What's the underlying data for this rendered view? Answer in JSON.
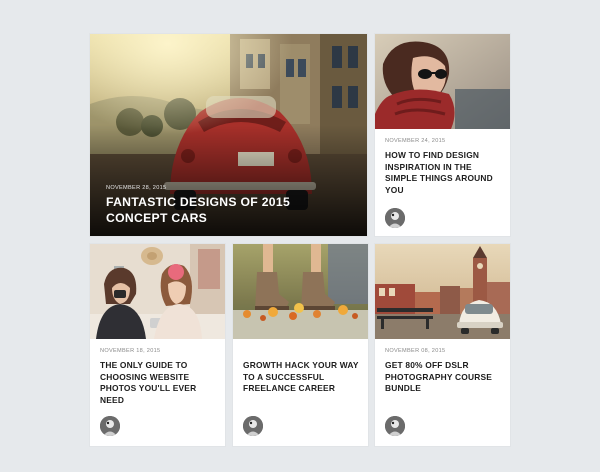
{
  "colors": {
    "page_background": "#e6e9ec",
    "card_background": "#ffffff",
    "title_text": "#1d1d1d",
    "date_text": "#8a8a8a",
    "featured_title_text": "#ffffff"
  },
  "featured": {
    "date": "NOVEMBER 28, 2015",
    "title": "FANTASTIC DESIGNS OF 2015 CONCEPT CARS",
    "image": "red-vintage-beetle-car-on-city-street"
  },
  "cards": [
    {
      "date": "NOVEMBER 24, 2015",
      "title": "HOW TO FIND DESIGN INSPIRATION IN THE SIMPLE THINGS AROUND YOU",
      "image": "woman-with-sunglasses-and-red-scarf",
      "avatar": "author-avatar"
    },
    {
      "date": "NOVEMBER 18, 2015",
      "title": "THE ONLY GUIDE TO CHOOSING WEBSITE PHOTOS YOU'LL EVER NEED",
      "image": "two-women-with-cameras",
      "avatar": "author-avatar"
    },
    {
      "date": "",
      "title": "GROWTH HACK YOUR WAY TO A SUCCESSFUL FREELANCE CAREER",
      "image": "boots-with-autumn-leaves",
      "avatar": "author-avatar"
    },
    {
      "date": "NOVEMBER 08, 2015",
      "title": "GET 80% OFF DSLR PHOTOGRAPHY COURSE BUNDLE",
      "image": "white-vintage-car-in-town-square",
      "avatar": "author-avatar"
    }
  ]
}
